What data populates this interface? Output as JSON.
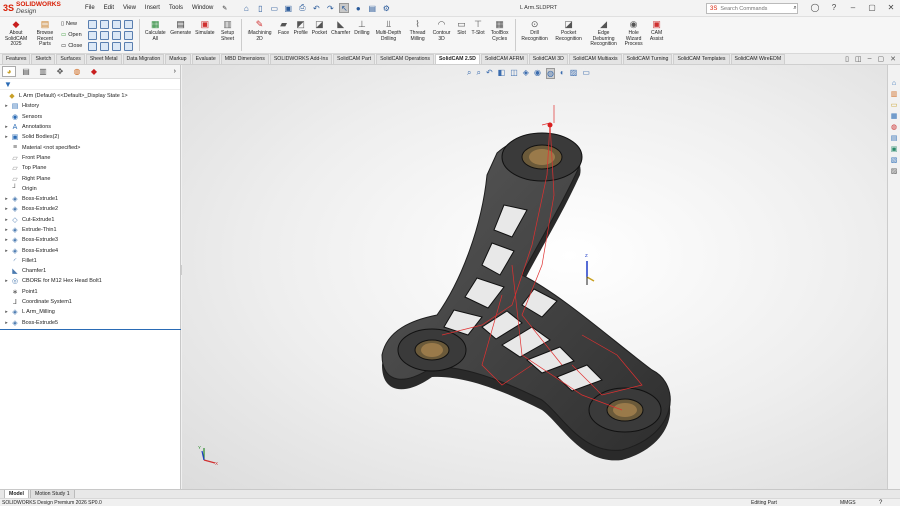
{
  "app": {
    "logo_mark": "3S",
    "brand": "SOLIDWORKS",
    "brand_suffix": "Design",
    "document_title": "L Arm.SLDPRT"
  },
  "menus": [
    "File",
    "Edit",
    "View",
    "Insert",
    "Tools",
    "Window"
  ],
  "search": {
    "placeholder": "Search Commands"
  },
  "ribbon": {
    "about": "About SolidCAM 2025",
    "browse": "Browse Recent Parts",
    "new": "New",
    "open": "Open",
    "close": "Close",
    "calculate_all": "Calculate All",
    "generate": "Generate",
    "simulate": "Simulate",
    "setup_sheet": "Setup Sheet",
    "imachining_2d": "iMachining 2D",
    "face": "Face",
    "profile": "Profile",
    "pocket": "Pocket",
    "chamfer": "Chamfer",
    "drilling": "Drilling",
    "multidepth": "Multi-Depth Drilling",
    "thread_milling": "Thread Milling",
    "contour_3d": "Contour 3D",
    "slot": "Slot",
    "t_slot": "T-Slot",
    "toolbox_cycles": "ToolBox Cycles",
    "drill_recognition": "Drill Recognition",
    "pocket_recognition": "Pocket Recognition",
    "edge_deburring": "Edge Deburring Recognition",
    "hole_wizard": "Hole Wizard Process",
    "cam_assist": "CAM Assist"
  },
  "tabs": [
    "Features",
    "Sketch",
    "Surfaces",
    "Sheet Metal",
    "Data Migration",
    "Markup",
    "Evaluate",
    "MBD Dimensions",
    "SOLIDWORKS Add-Ins",
    "SolidCAM Part",
    "SolidCAM Operations",
    "SolidCAM 2.5D",
    "SolidCAM AFRM",
    "SolidCAM 3D",
    "SolidCAM Multiaxis",
    "SolidCAM Turning",
    "SolidCAM Templates",
    "SolidCAM WireEDM"
  ],
  "active_tab": "SolidCAM 2.5D",
  "tree": [
    {
      "label": "L Arm (Default) <<Default>_Display State 1>",
      "icon": "part-icon",
      "expand": ""
    },
    {
      "label": "History",
      "icon": "history-icon",
      "expand": "▸"
    },
    {
      "label": "Sensors",
      "icon": "sensor-icon",
      "expand": ""
    },
    {
      "label": "Annotations",
      "icon": "annotation-icon",
      "expand": "▸"
    },
    {
      "label": "Solid Bodies(2)",
      "icon": "solid-bodies-icon",
      "expand": "▸"
    },
    {
      "label": "Material <not specified>",
      "icon": "material-icon",
      "expand": ""
    },
    {
      "label": "Front Plane",
      "icon": "plane-icon",
      "expand": ""
    },
    {
      "label": "Top Plane",
      "icon": "plane-icon",
      "expand": ""
    },
    {
      "label": "Right Plane",
      "icon": "plane-icon",
      "expand": ""
    },
    {
      "label": "Origin",
      "icon": "origin-icon",
      "expand": ""
    },
    {
      "label": "Boss-Extrude1",
      "icon": "extrude-icon",
      "expand": "▸"
    },
    {
      "label": "Boss-Extrude2",
      "icon": "extrude-icon",
      "expand": "▸"
    },
    {
      "label": "Cut-Extrude1",
      "icon": "cut-extrude-icon",
      "expand": "▸"
    },
    {
      "label": "Extrude-Thin1",
      "icon": "extrude-icon",
      "expand": "▸"
    },
    {
      "label": "Boss-Extrude3",
      "icon": "extrude-icon",
      "expand": "▸"
    },
    {
      "label": "Boss-Extrude4",
      "icon": "extrude-icon",
      "expand": "▸"
    },
    {
      "label": "Fillet1",
      "icon": "fillet-icon",
      "expand": ""
    },
    {
      "label": "Chamfer1",
      "icon": "chamfer-icon",
      "expand": ""
    },
    {
      "label": "CBORE for M12 Hex Head Bolt1",
      "icon": "hole-icon",
      "expand": "▸"
    },
    {
      "label": "Point1",
      "icon": "point-icon",
      "expand": ""
    },
    {
      "label": "Coordinate System1",
      "icon": "coordinate-system-icon",
      "expand": ""
    },
    {
      "label": "L Arm_Milling",
      "icon": "extrude-icon",
      "expand": "▸"
    },
    {
      "label": "Boss-Extrude5",
      "icon": "extrude-icon",
      "expand": "▸"
    }
  ],
  "triad": {
    "x": "X",
    "y": "Y",
    "z": "Z"
  },
  "bottom_tabs": [
    "Model",
    "Motion Study 1"
  ],
  "status": {
    "product": "SOLIDWORKS Design Premium 2026 SP0.0",
    "mode": "Editing Part",
    "units": "MMGS",
    "help": "?"
  }
}
